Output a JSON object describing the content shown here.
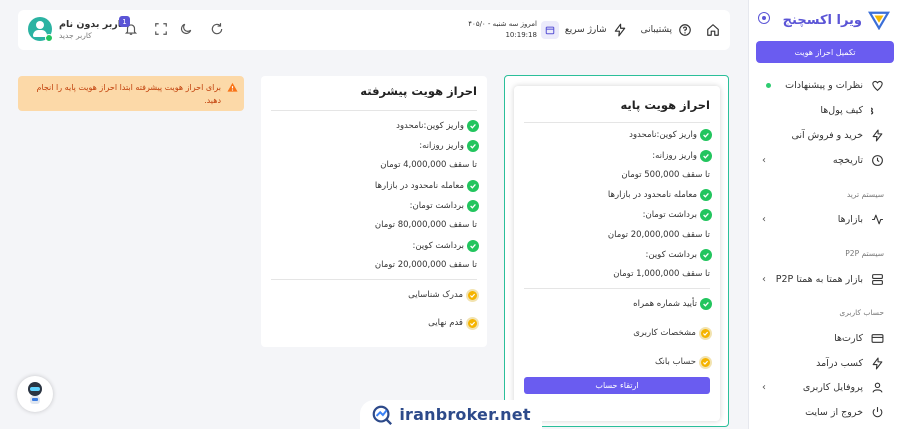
{
  "sidebar": {
    "brand": "ویرا اکسچنج",
    "kyc_button": "تکمیل احراز هویت",
    "items": [
      {
        "label": "نظرات و پیشنهادات",
        "icon": "heart-icon"
      },
      {
        "label": "کیف پول‌ها",
        "icon": "bitcoin-icon"
      },
      {
        "label": "خرید و فروش آنی",
        "icon": "bolt-icon"
      },
      {
        "label": "تاریخچه",
        "icon": "clock-icon"
      },
      {
        "label": "بازارها",
        "icon": "activity-icon"
      },
      {
        "label": "بازار همتا به همتا P2P",
        "icon": "server-icon"
      },
      {
        "label": "کارت‌ها",
        "icon": "card-icon"
      },
      {
        "label": "کسب درآمد",
        "icon": "bolt-icon"
      },
      {
        "label": "پروفایل کاربری",
        "icon": "user-icon"
      },
      {
        "label": "خروج از سایت",
        "icon": "power-icon"
      }
    ],
    "sections": {
      "trade": "سیستم ترید",
      "p2p": "سیستم P2P",
      "account": "حساب کاربری"
    }
  },
  "header": {
    "user_name": "کاربر بدون نام",
    "user_role": "کاربر جدید",
    "notification_count": "1",
    "support": "پشتیبانی",
    "quick_charge": "شارژ سریع",
    "date": "امروز سه شنبه - ۴۰۵/۰",
    "time": "10:19:18"
  },
  "alert": {
    "text": "برای احراز هویت پیشرفته ابتدا احراز هویت پایه را انجام دهید."
  },
  "advanced": {
    "title": "احراز هویت پیشرفته",
    "rows": [
      "واریز کوین:نامحدود",
      "واریز روزانه:",
      "تا سقف 4,000,000 تومان",
      "معامله نامحدود در بازارها",
      "برداشت تومان:",
      "تا سقف 80,000,000 تومان",
      "برداشت کوین:",
      "تا سقف 20,000,000 تومان"
    ],
    "requirements": [
      "مدرک شناسایی",
      "قدم نهایی"
    ]
  },
  "basic": {
    "title": "احراز هویت پایه",
    "rows": [
      "واریز کوین:نامحدود",
      "واریز روزانه:",
      "تا سقف 500,000 تومان",
      "معامله نامحدود در بازارها",
      "برداشت تومان:",
      "تا سقف 20,000,000 تومان",
      "برداشت کوین:",
      "تا سقف 1,000,000 تومان"
    ],
    "requirements": [
      "تأیید شماره همراه",
      "مشخصات کاربری",
      "حساب بانک"
    ],
    "upgrade_button": "ارتقاء حساب"
  },
  "watermark": "iranbroker.net",
  "colors": {
    "accent": "#6a5cf0",
    "success": "#22c55e",
    "warning": "#f5b400",
    "alert_bg": "#fcd9a8"
  }
}
